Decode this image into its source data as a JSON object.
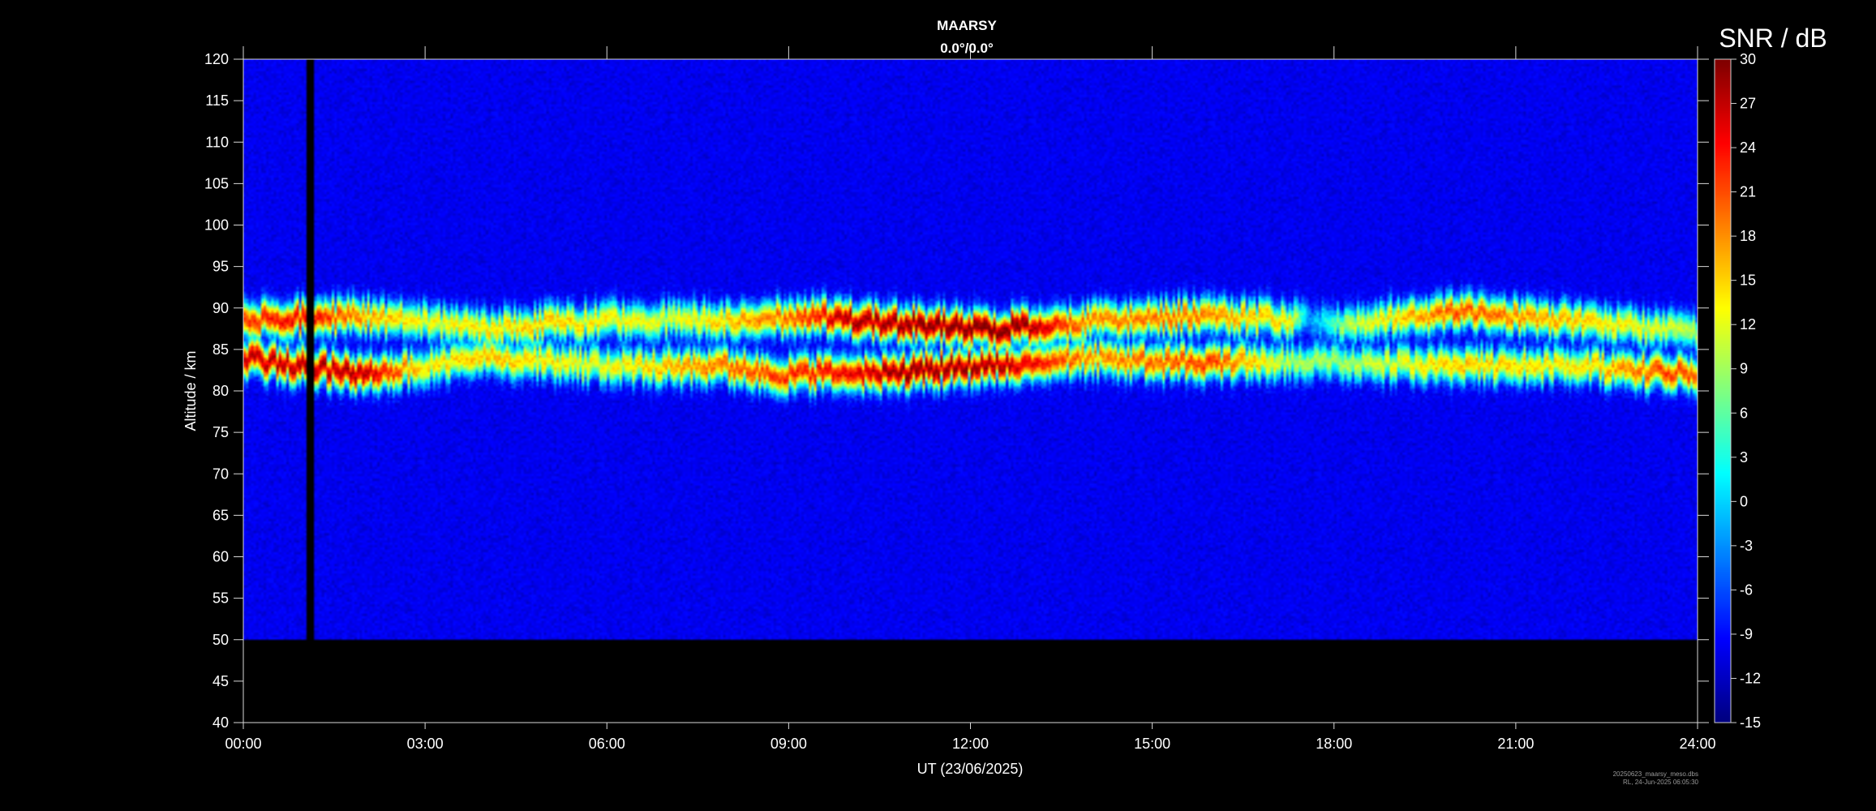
{
  "chart_data": {
    "type": "heatmap",
    "title": "MAARSY",
    "subtitle": "0.0°/0.0°",
    "xlabel": "UT (23/06/2025)",
    "ylabel": "Altitude / km",
    "xlim": [
      0,
      24
    ],
    "ylim": [
      40,
      120
    ],
    "x_tick_labels": [
      "00:00",
      "03:00",
      "06:00",
      "09:00",
      "12:00",
      "15:00",
      "18:00",
      "21:00",
      "24:00"
    ],
    "y_tick_values": [
      40,
      45,
      50,
      55,
      60,
      65,
      70,
      75,
      80,
      85,
      90,
      95,
      100,
      105,
      110,
      115,
      120
    ],
    "data_altitude_range": [
      50,
      120
    ],
    "grid": false,
    "colorbar": {
      "title": "SNR / dB",
      "range": [
        -15,
        30
      ],
      "tick_values": [
        30,
        27,
        24,
        21,
        18,
        15,
        12,
        9,
        6,
        3,
        0,
        -3,
        -6,
        -9,
        -12,
        -15
      ],
      "colormap": "jet"
    },
    "background_snr": -11,
    "data_gap_hours": [
      1.05,
      1.15
    ],
    "echo_layers": [
      {
        "center_km": [
          [
            0,
            88.5
          ],
          [
            2,
            89
          ],
          [
            4,
            87.5
          ],
          [
            6,
            88.5
          ],
          [
            8,
            88.5
          ],
          [
            9.5,
            89
          ],
          [
            11,
            88
          ],
          [
            12.5,
            87.5
          ],
          [
            14,
            88.5
          ],
          [
            16,
            89
          ],
          [
            17.4,
            88.5
          ],
          [
            18,
            88
          ],
          [
            20,
            89.5
          ],
          [
            22,
            88.5
          ],
          [
            24,
            87
          ]
        ],
        "snr_db": [
          [
            0,
            22
          ],
          [
            1,
            25
          ],
          [
            2,
            18
          ],
          [
            3,
            13
          ],
          [
            5,
            16
          ],
          [
            7,
            12
          ],
          [
            9,
            20
          ],
          [
            10,
            28
          ],
          [
            11.5,
            30
          ],
          [
            12.8,
            30
          ],
          [
            14,
            18
          ],
          [
            15.5,
            20
          ],
          [
            17.3,
            14
          ],
          [
            17.6,
            -3
          ],
          [
            18.2,
            10
          ],
          [
            20,
            21
          ],
          [
            22,
            16
          ],
          [
            24,
            10
          ]
        ]
      },
      {
        "center_km": [
          [
            0,
            84
          ],
          [
            1,
            83
          ],
          [
            2,
            82
          ],
          [
            4,
            84
          ],
          [
            6,
            83
          ],
          [
            8,
            83
          ],
          [
            9,
            82
          ],
          [
            10.5,
            82
          ],
          [
            12,
            83
          ],
          [
            14,
            84
          ],
          [
            15,
            83.5
          ],
          [
            16.5,
            83.5
          ],
          [
            18,
            83.5
          ],
          [
            20,
            83
          ],
          [
            22,
            83
          ],
          [
            24,
            82
          ]
        ],
        "snr_db": [
          [
            0,
            27
          ],
          [
            2,
            28
          ],
          [
            3,
            14
          ],
          [
            4,
            16
          ],
          [
            6,
            13
          ],
          [
            8,
            20
          ],
          [
            10,
            25
          ],
          [
            11,
            30
          ],
          [
            12.5,
            28
          ],
          [
            14,
            18
          ],
          [
            16,
            22
          ],
          [
            17.3,
            10
          ],
          [
            18,
            9
          ],
          [
            20,
            16
          ],
          [
            22,
            14
          ],
          [
            23.5,
            22
          ],
          [
            24,
            20
          ]
        ]
      }
    ]
  },
  "footer": {
    "filename": "20250623_maarsy_meso.dbs",
    "credit": "RL, 24-Jun-2025 06:05:30"
  }
}
